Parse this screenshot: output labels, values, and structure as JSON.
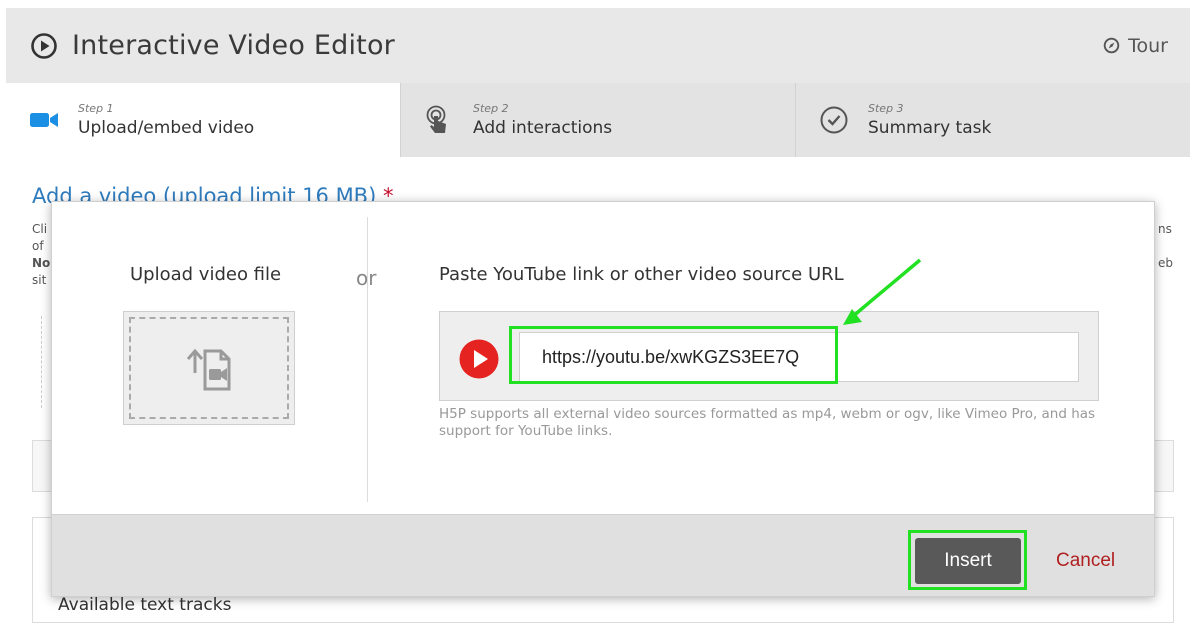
{
  "header": {
    "title": "Interactive Video Editor",
    "tour_label": "Tour"
  },
  "tabs": [
    {
      "step": "Step 1",
      "label": "Upload/embed video",
      "icon": "video-camera-icon",
      "active": true
    },
    {
      "step": "Step 2",
      "label": "Add interactions",
      "icon": "touch-icon",
      "active": false
    },
    {
      "step": "Step 3",
      "label": "Summary task",
      "icon": "checkmark-circle-icon",
      "active": false
    }
  ],
  "page": {
    "heading": "Add a video (upload limit 16 MB)",
    "required_mark": "*",
    "fragments": {
      "line1": "Cli",
      "line2": "of",
      "line3": "No",
      "line4": "sit",
      "right1": "ns",
      "right2": "eb"
    },
    "text_tracks_label": "Available text tracks"
  },
  "modal": {
    "upload_label": "Upload video file",
    "or_label": "or",
    "url_label": "Paste YouTube link or other video source URL",
    "url_value": "https://youtu.be/xwKGZS3EE7Q",
    "help_text": "H5P supports all external video sources formatted as mp4, webm or ogv, like Vimeo Pro, and has support for YouTube links.",
    "insert_label": "Insert",
    "cancel_label": "Cancel"
  },
  "colors": {
    "accent_blue": "#2e7bbd",
    "required_red": "#c8102e",
    "youtube_red": "#e52421",
    "cancel_red": "#b02020",
    "annotation_green": "#22e022",
    "header_bg": "#e8e8e8"
  }
}
